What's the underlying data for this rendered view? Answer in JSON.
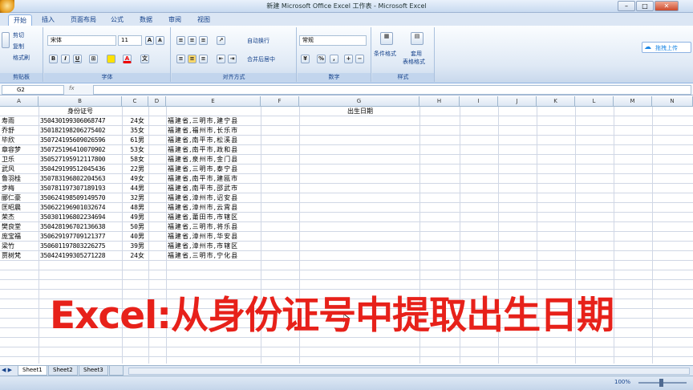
{
  "window": {
    "title": "新建 Microsoft Office Excel 工作表 - Microsoft Excel"
  },
  "ribbon": {
    "tabs": [
      "开始",
      "插入",
      "页面布局",
      "公式",
      "数据",
      "审阅",
      "视图"
    ],
    "clipboard": {
      "cut": "剪切",
      "copy": "复制",
      "format_painter": "格式刷",
      "label": "剪贴板"
    },
    "font": {
      "name": "宋体",
      "size": "11",
      "label": "字体",
      "grow": "A",
      "shrink": "A",
      "bold": "B",
      "italic": "I",
      "underline": "U"
    },
    "alignment": {
      "wrap": "自动换行",
      "merge": "合并后居中",
      "label": "对齐方式"
    },
    "number": {
      "format": "常规",
      "percent": "%",
      "label": "数字"
    },
    "styles": {
      "conditional": "条件格式",
      "table_format": "套用",
      "table_format2": "表格格式",
      "label": "样式"
    },
    "extra": {
      "button": "拖拽上传"
    }
  },
  "formula_bar": {
    "name_box": "G2",
    "fx": "fx"
  },
  "columns": [
    "A",
    "B",
    "C",
    "D",
    "E",
    "F",
    "G",
    "H",
    "I",
    "J",
    "K",
    "L",
    "M",
    "N"
  ],
  "headers": {
    "id": "身份证号",
    "birthdate": "出生日期"
  },
  "rows": [
    {
      "name": "寿雨",
      "id": "350430199306068747",
      "age": "24",
      "sex": "女",
      "addr": "福建省,三明市,建宁县"
    },
    {
      "name": "乔舒",
      "id": "350182198206275402",
      "age": "35",
      "sex": "女",
      "addr": "福建省,福州市,长乐市"
    },
    {
      "name": "毕欣",
      "id": "350724195609026596",
      "age": "61",
      "sex": "男",
      "addr": "福建省,南平市,松溪县"
    },
    {
      "name": "章容梦",
      "id": "350725196410070902",
      "age": "53",
      "sex": "女",
      "addr": "福建省,南平市,政和县"
    },
    {
      "name": "卫乐",
      "id": "350527195912117800",
      "age": "58",
      "sex": "女",
      "addr": "福建省,泉州市,金门县"
    },
    {
      "name": "武风",
      "id": "350429199512045436",
      "age": "22",
      "sex": "男",
      "addr": "福建省,三明市,泰宁县"
    },
    {
      "name": "鲁羽桂",
      "id": "350783196802204563",
      "age": "49",
      "sex": "女",
      "addr": "福建省,南平市,建瓯市"
    },
    {
      "name": "步梅",
      "id": "350781197307189193",
      "age": "44",
      "sex": "男",
      "addr": "福建省,南平市,邵武市"
    },
    {
      "name": "郦仁豪",
      "id": "350624198509149570",
      "age": "32",
      "sex": "男",
      "addr": "福建省,漳州市,诏安县"
    },
    {
      "name": "匡昭晨",
      "id": "350622196901032674",
      "age": "48",
      "sex": "男",
      "addr": "福建省,漳州市,云霄县"
    },
    {
      "name": "荣杰",
      "id": "350301196802234694",
      "age": "49",
      "sex": "男",
      "addr": "福建省,莆田市,市辖区"
    },
    {
      "name": "樊良堂",
      "id": "350428196702136638",
      "age": "50",
      "sex": "男",
      "addr": "福建省,三明市,将乐县"
    },
    {
      "name": "庞宝福",
      "id": "350629197709121377",
      "age": "40",
      "sex": "男",
      "addr": "福建省,漳州市,华安县"
    },
    {
      "name": "梁竹",
      "id": "350601197803226275",
      "age": "39",
      "sex": "男",
      "addr": "福建省,漳州市,市辖区"
    },
    {
      "name": "贾树梵",
      "id": "350424199305271228",
      "age": "24",
      "sex": "女",
      "addr": "福建省,三明市,宁化县"
    }
  ],
  "overlay_text": "Excel:从身份证号中提取出生日期",
  "sheets": [
    "Sheet1",
    "Sheet2",
    "Sheet3"
  ],
  "status": {
    "zoom": "100%"
  }
}
